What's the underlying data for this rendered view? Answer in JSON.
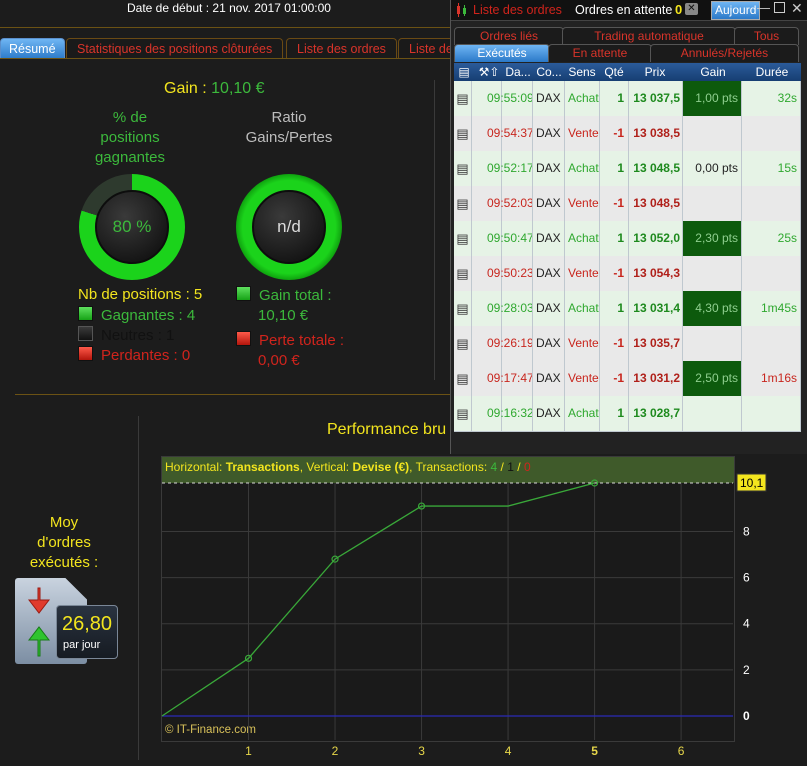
{
  "header": {
    "start_date": "Date de début : 21 nov. 2017 01:00:00"
  },
  "tabs": [
    "Résumé",
    "Statistiques des positions clôturées",
    "Liste des ordres",
    "Liste de"
  ],
  "summary": {
    "gain_label": "Gain :",
    "gain_value": "10,10 €",
    "pct_title": "% de\npositions\ngagnantes",
    "pct_value": "80 %",
    "pct_fraction": 0.8,
    "ratio_title": "Ratio\nGains/Pertes",
    "ratio_value": "n/d",
    "nb_positions": "Nb de positions : 5",
    "winners": "Gagnantes : 4",
    "neutral": "Neutres : 1",
    "losers": "Perdantes : 0",
    "gain_total_label": "Gain total :",
    "gain_total_value": "10,10 €",
    "perte_total_label": "Perte totale :",
    "perte_total_value": "0,00 €"
  },
  "orders_window": {
    "title": "Liste des ordres",
    "pending_label": "Ordres en attente",
    "pending_count": "0",
    "today_button": "Aujourd",
    "tabs_row1": [
      "Ordres liés",
      "Trading automatique",
      "Tous"
    ],
    "tabs_row2": [
      "Exécutés",
      "En attente",
      "Annulés/Rejetés"
    ],
    "columns": [
      "Da...",
      "Co...",
      "Sens",
      "Qté",
      "Prix",
      "Gain",
      "Durée"
    ],
    "rows": [
      {
        "time": "09:55:09",
        "code": "DAX",
        "side": "Achat",
        "qty": "1",
        "price": "13 037,5",
        "gain": "1,00 pts",
        "duration": "32s",
        "type": "buy",
        "gain_hl": true
      },
      {
        "time": "09:54:37",
        "code": "DAX",
        "side": "Vente",
        "qty": "-1",
        "price": "13 038,5",
        "gain": "",
        "duration": "",
        "type": "sell",
        "gain_hl": false
      },
      {
        "time": "09:52:17",
        "code": "DAX",
        "side": "Achat",
        "qty": "1",
        "price": "13 048,5",
        "gain": "0,00 pts",
        "duration": "15s",
        "type": "buy",
        "gain_hl": false
      },
      {
        "time": "09:52:03",
        "code": "DAX",
        "side": "Vente",
        "qty": "-1",
        "price": "13 048,5",
        "gain": "",
        "duration": "",
        "type": "sell",
        "gain_hl": false
      },
      {
        "time": "09:50:47",
        "code": "DAX",
        "side": "Achat",
        "qty": "1",
        "price": "13 052,0",
        "gain": "2,30 pts",
        "duration": "25s",
        "type": "buy",
        "gain_hl": true
      },
      {
        "time": "09:50:23",
        "code": "DAX",
        "side": "Vente",
        "qty": "-1",
        "price": "13 054,3",
        "gain": "",
        "duration": "",
        "type": "sell",
        "gain_hl": false
      },
      {
        "time": "09:28:03",
        "code": "DAX",
        "side": "Achat",
        "qty": "1",
        "price": "13 031,4",
        "gain": "4,30 pts",
        "duration": "1m45s",
        "type": "buy",
        "gain_hl": true
      },
      {
        "time": "09:26:19",
        "code": "DAX",
        "side": "Vente",
        "qty": "-1",
        "price": "13 035,7",
        "gain": "",
        "duration": "",
        "type": "sell",
        "gain_hl": false
      },
      {
        "time": "09:17:47",
        "code": "DAX",
        "side": "Vente",
        "qty": "-1",
        "price": "13 031,2",
        "gain": "2,50 pts",
        "duration": "1m16s",
        "type": "sell",
        "gain_hl": true,
        "duration_red": true
      },
      {
        "time": "09:16:32",
        "code": "DAX",
        "side": "Achat",
        "qty": "1",
        "price": "13 028,7",
        "gain": "",
        "duration": "",
        "type": "buy",
        "gain_hl": false
      }
    ]
  },
  "moy": {
    "title": "Moy\nd'ordres\nexécutés :",
    "value": "26,80",
    "unit": "par jour"
  },
  "chart_data": {
    "type": "line",
    "title": "Performance bru",
    "info": {
      "h_label": "Horizontal:",
      "h_val": "Transactions",
      "v_label": "Vertical:",
      "v_val": "Devise (€)",
      "t_label": "Transactions:",
      "t_win": "4",
      "t_neutral": "1",
      "t_loss": "0"
    },
    "x": [
      0,
      1,
      2,
      3,
      4,
      5
    ],
    "y": [
      0,
      2.5,
      6.8,
      9.1,
      9.1,
      10.1
    ],
    "xticks": [
      "1",
      "2",
      "3",
      "4",
      "5",
      "6"
    ],
    "yticks": [
      "0",
      "2",
      "4",
      "6",
      "8"
    ],
    "last_value_label": "10,1",
    "xlim": [
      0,
      6.6
    ],
    "ylim": [
      -1,
      11.3
    ],
    "copyright": "© IT-Finance.com",
    "colors": {
      "line": "#39a839",
      "zero_line": "#2a2ab8",
      "grid": "#3a3a3a"
    }
  }
}
